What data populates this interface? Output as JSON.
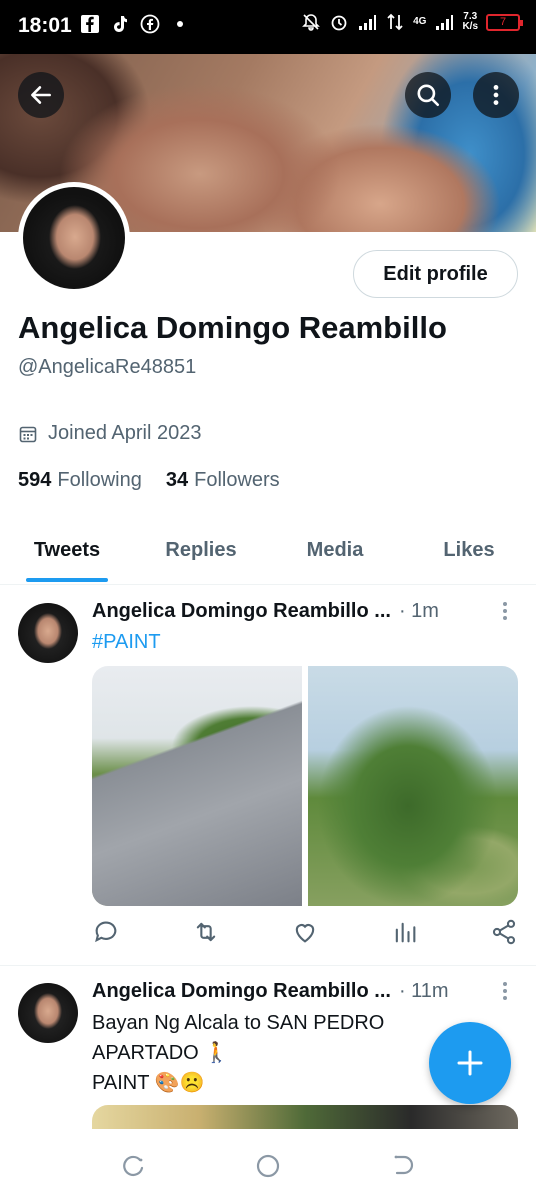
{
  "status_bar": {
    "time": "18:01",
    "network": "4G",
    "speed_value": "7.3",
    "speed_unit": "K/s",
    "battery": "7"
  },
  "profile": {
    "edit_button": "Edit profile",
    "name": "Angelica Domingo Reambillo",
    "handle": "@AngelicaRe48851",
    "joined": "Joined April 2023",
    "following_count": "594",
    "following_label": "Following",
    "followers_count": "34",
    "followers_label": "Followers"
  },
  "tabs": [
    {
      "label": "Tweets",
      "active": true
    },
    {
      "label": "Replies",
      "active": false
    },
    {
      "label": "Media",
      "active": false
    },
    {
      "label": "Likes",
      "active": false
    }
  ],
  "tweets": [
    {
      "author": "Angelica Domingo Reambillo ...",
      "time": "· 1m",
      "text": "#PAINT"
    },
    {
      "author": "Angelica Domingo Reambillo ...",
      "time": "· 11m",
      "line1": "Bayan Ng Alcala to SAN PEDRO",
      "line2": "APARTADO 🚶",
      "line3": "PAINT 🎨☹️"
    }
  ],
  "colors": {
    "accent": "#1d9bf0",
    "text_primary": "#0f1419",
    "text_secondary": "#536471"
  }
}
